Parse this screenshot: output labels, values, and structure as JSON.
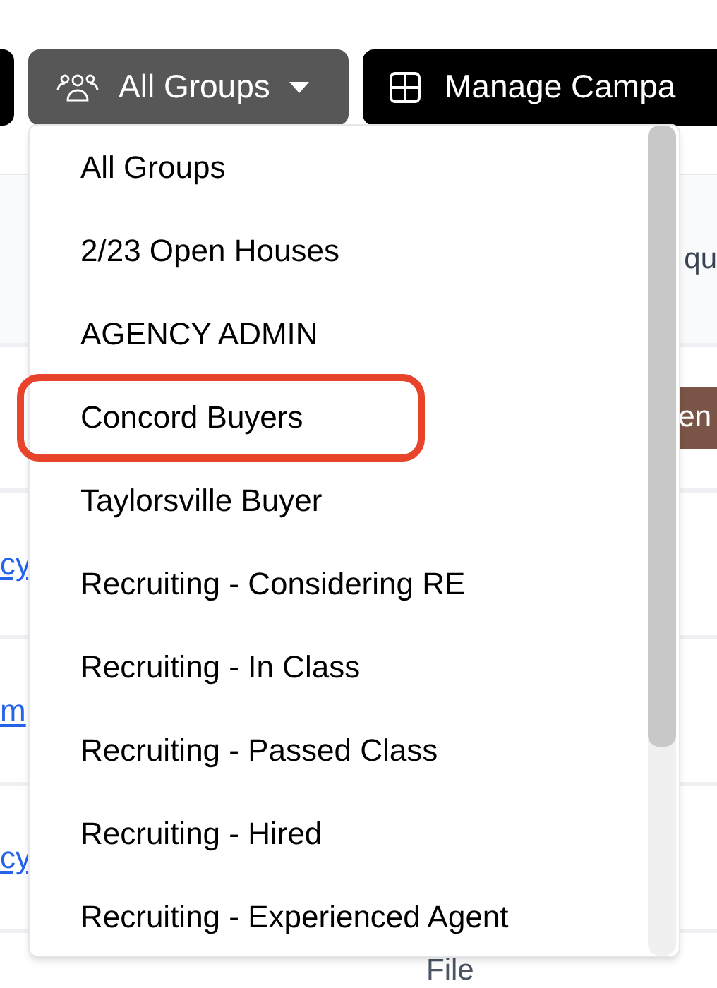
{
  "toolbar": {
    "group_filter": {
      "label": "All Groups",
      "open": true
    },
    "manage_button": {
      "label": "Manage Campa"
    }
  },
  "group_menu": {
    "items": [
      {
        "label": "All Groups",
        "highlighted": false
      },
      {
        "label": "2/23 Open Houses",
        "highlighted": false
      },
      {
        "label": "AGENCY ADMIN",
        "highlighted": false
      },
      {
        "label": "Concord Buyers",
        "highlighted": true
      },
      {
        "label": "Taylorsville Buyer",
        "highlighted": false
      },
      {
        "label": "Recruiting - Considering RE",
        "highlighted": false
      },
      {
        "label": "Recruiting - In Class",
        "highlighted": false
      },
      {
        "label": "Recruiting - Passed Class",
        "highlighted": false
      },
      {
        "label": "Recruiting - Hired",
        "highlighted": false
      },
      {
        "label": "Recruiting - Experienced Agent",
        "highlighted": false
      }
    ]
  },
  "background_table": {
    "header_fragment": "qu",
    "badge_fragment": "en",
    "links": [
      "cy",
      "m",
      "cy"
    ],
    "footer_fragment": "File"
  }
}
